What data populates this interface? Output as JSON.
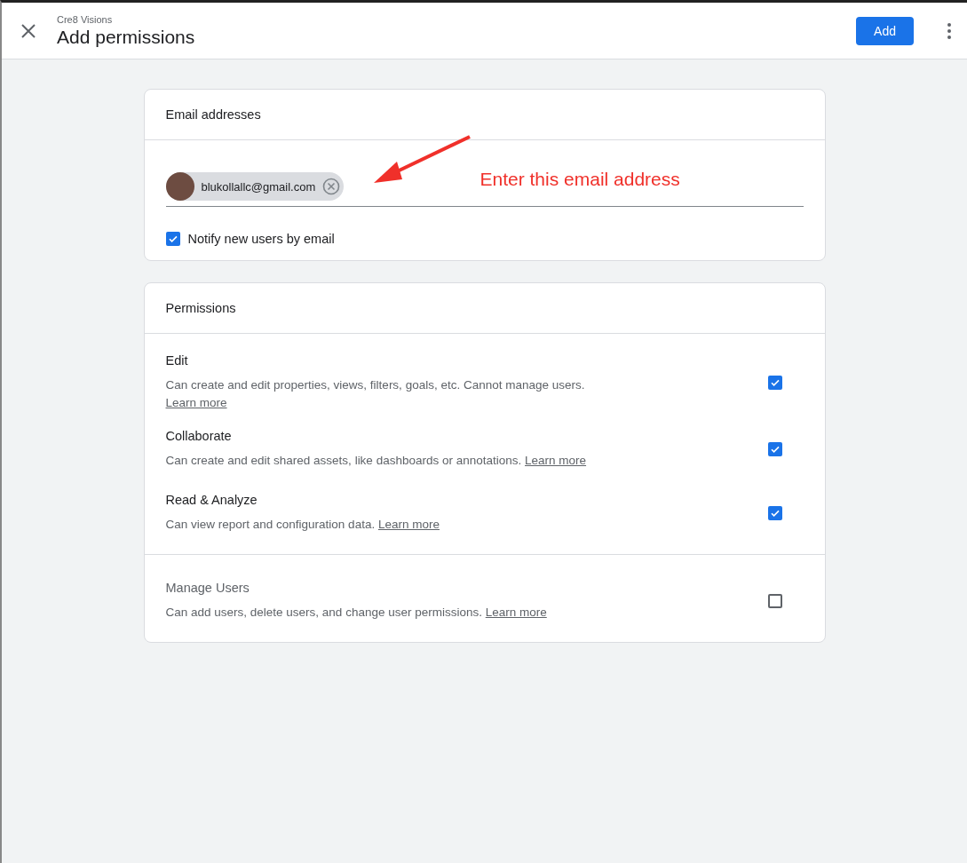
{
  "header": {
    "subtitle": "Cre8 Visions",
    "title": "Add permissions",
    "add_button": "Add"
  },
  "email_card": {
    "title": "Email addresses",
    "chips": [
      {
        "email": "blukollallc@gmail.com"
      }
    ],
    "annotation": "Enter this email address",
    "notify": {
      "label": "Notify new users by email",
      "checked": true
    }
  },
  "permissions_card": {
    "title": "Permissions",
    "groups": [
      {
        "items": [
          {
            "title": "Edit",
            "description": "Can create and edit properties, views, filters, goals, etc. Cannot manage users.",
            "link": "Learn more",
            "checked": true
          },
          {
            "title": "Collaborate",
            "description": "Can create and edit shared assets, like dashboards or annotations.",
            "link": "Learn more",
            "checked": true
          },
          {
            "title": "Read & Analyze",
            "description": "Can view report and configuration data.",
            "link": "Learn more",
            "checked": true
          }
        ]
      },
      {
        "items": [
          {
            "title": "Manage Users",
            "description": "Can add users, delete users, and change user permissions.",
            "link": "Learn more",
            "checked": false
          }
        ]
      }
    ]
  }
}
